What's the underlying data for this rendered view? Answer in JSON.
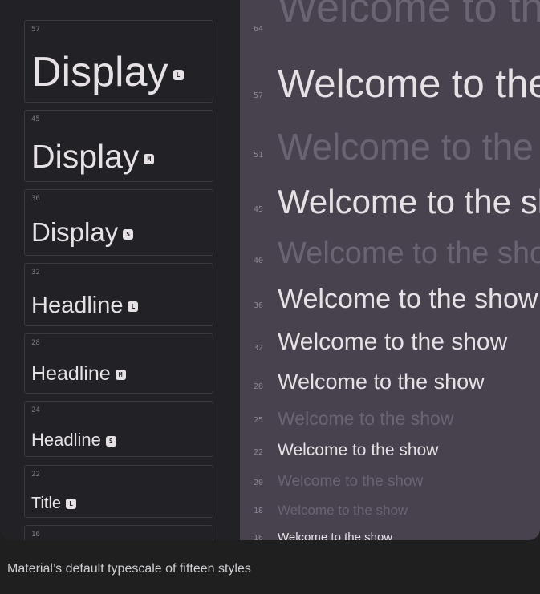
{
  "styles": [
    {
      "size": "57",
      "name": "Display",
      "badge": "L"
    },
    {
      "size": "45",
      "name": "Display",
      "badge": "M"
    },
    {
      "size": "36",
      "name": "Display",
      "badge": "S"
    },
    {
      "size": "32",
      "name": "Headline",
      "badge": "L"
    },
    {
      "size": "28",
      "name": "Headline",
      "badge": "M"
    },
    {
      "size": "24",
      "name": "Headline",
      "badge": "S"
    },
    {
      "size": "22",
      "name": "Title",
      "badge": "L"
    },
    {
      "size": "16",
      "name": "",
      "badge": ""
    }
  ],
  "preview": {
    "sample_text": "Welcome to the show",
    "rows": [
      {
        "size": "64",
        "active": false
      },
      {
        "size": "57",
        "active": true
      },
      {
        "size": "51",
        "active": false
      },
      {
        "size": "45",
        "active": true
      },
      {
        "size": "40",
        "active": false
      },
      {
        "size": "36",
        "active": true
      },
      {
        "size": "32",
        "active": true
      },
      {
        "size": "28",
        "active": true
      },
      {
        "size": "25",
        "active": false
      },
      {
        "size": "22",
        "active": true
      },
      {
        "size": "20",
        "active": false
      },
      {
        "size": "18",
        "active": false
      },
      {
        "size": "16",
        "active": true
      }
    ]
  },
  "caption": "Material’s default typescale of fifteen styles",
  "colors": {
    "left_bg": "#222126",
    "right_bg": "#48424f",
    "text": "#e6e1e5",
    "faded_text": "#6a6472"
  }
}
